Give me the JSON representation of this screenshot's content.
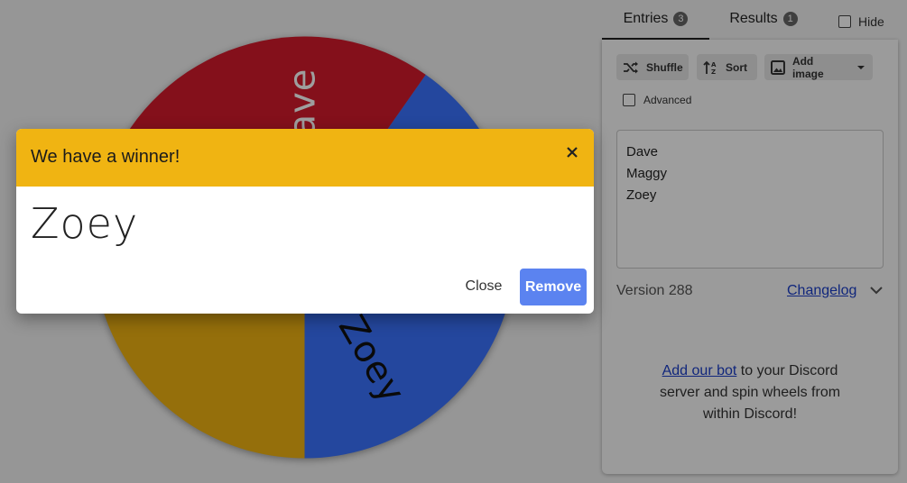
{
  "wheel": {
    "segments": [
      {
        "name": "Dave",
        "color": "#3b73ff"
      },
      {
        "name": "Zoey",
        "color": "#f0b412"
      },
      {
        "name": "Maggy",
        "color": "#d61a2c"
      }
    ]
  },
  "tabs": {
    "entries": {
      "label": "Entries",
      "count": "3"
    },
    "results": {
      "label": "Results",
      "count": "1"
    },
    "hide_label": "Hide"
  },
  "toolbar": {
    "shuffle_label": "Shuffle",
    "sort_label": "Sort",
    "add_image_label": "Add image",
    "advanced_label": "Advanced"
  },
  "entries": [
    "Dave",
    "Maggy",
    "Zoey"
  ],
  "footer": {
    "version": "Version 288",
    "changelog": "Changelog"
  },
  "discord": {
    "link_text": "Add our bot",
    "text_line1": " to your Discord",
    "text_line2": "server and spin wheels from",
    "text_line3": "within Discord!"
  },
  "dialog": {
    "title": "We have a winner!",
    "winner": "Zoey",
    "close_label": "Close",
    "remove_label": "Remove"
  },
  "colors": {
    "dialog_header": "#f0b412",
    "remove_button": "#5b83f0",
    "link": "#1a3ec8"
  }
}
